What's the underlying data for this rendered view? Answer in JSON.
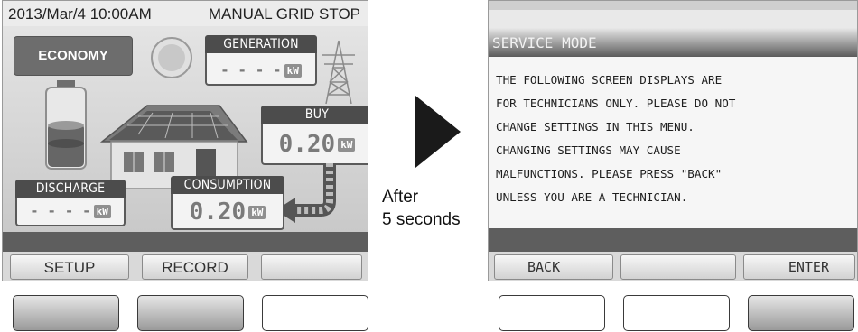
{
  "left_screen": {
    "status_date": "2013/Mar/4 10:00AM",
    "status_mode": "MANUAL GRID STOP",
    "mode_button": "ECONOMY",
    "generation": {
      "label": "GENERATION",
      "value": "- - - -",
      "unit": "kW"
    },
    "buy": {
      "label": "BUY",
      "value": "0.20",
      "unit": "kW"
    },
    "discharge": {
      "label": "DISCHARGE",
      "value": "- - - -",
      "unit": "kW"
    },
    "consumption": {
      "label": "CONSUMPTION",
      "value": "0.20",
      "unit": "kW"
    },
    "softkeys": [
      "SETUP",
      "RECORD",
      ""
    ]
  },
  "caption": {
    "line1": "After",
    "line2": "5 seconds"
  },
  "right_screen": {
    "title": "SERVICE MODE",
    "message_lines": [
      "THE FOLLOWING SCREEN DISPLAYS ARE",
      "FOR TECHNICIANS ONLY. PLEASE DO NOT",
      "CHANGE SETTINGS IN THIS MENU.",
      "CHANGING SETTINGS MAY CAUSE",
      "MALFUNCTIONS. PLEASE PRESS \"BACK\"",
      "UNLESS YOU ARE A TECHNICIAN."
    ],
    "softkeys": [
      "BACK",
      "",
      "ENTER"
    ]
  },
  "hardware_buttons": {
    "left": [
      "highlighted",
      "highlighted",
      "plain"
    ],
    "right": [
      "plain",
      "plain",
      "highlighted"
    ]
  },
  "colors": {
    "panel_header": "#4c4c4c",
    "stripe": "#5e5e5e",
    "arrow": "#1a1a1a"
  }
}
